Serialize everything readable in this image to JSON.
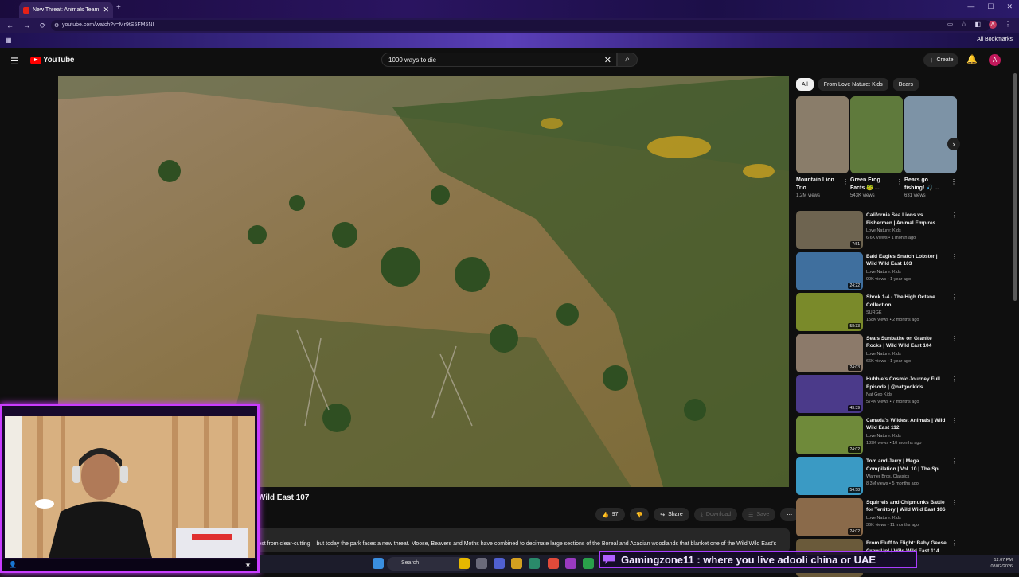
{
  "browser": {
    "tab_title": "New Threat: Animals Team...",
    "new_tab": "+",
    "url": "youtube.com/watch?v=Mr9tS5FM5NI",
    "all_bookmarks": "All Bookmarks",
    "profile_initial": "A"
  },
  "youtube": {
    "logo": "YouTube",
    "search_query": "1000 ways to die",
    "create_label": "Create",
    "avatar_initial": "A"
  },
  "video": {
    "title_visible": "Wild East 107",
    "likes": "97",
    "share": "Share",
    "download": "Download",
    "save": "Save",
    "description": "rest from clear-cutting – but today the park faces a new threat. Moose, Beavers and Moths have combined to decimate large sections of the Boreal and Acadian woodlands that blanket one of the Wild Wild East's"
  },
  "chips": [
    "All",
    "From Love Nature: Kids",
    "Bears"
  ],
  "shorts": [
    {
      "title": "Mountain Lion Trio",
      "views": "1.2M views",
      "thumb": "#8a7d6a"
    },
    {
      "title": "Green Frog Facts 🐸 ...",
      "views": "543K views",
      "thumb": "#5f7a3c"
    },
    {
      "title": "Bears go fishing! 🎣 ...",
      "views": "631 views",
      "thumb": "#7d93a6"
    }
  ],
  "recommended": [
    {
      "title": "California Sea Lions vs. Fishermen | Animal Empires ...",
      "channel": "Love Nature: Kids",
      "meta": "6.6K views • 1 month ago",
      "duration": "7:51",
      "thumb": "#6e6450"
    },
    {
      "title": "Bald Eagles Snatch Lobster | Wild Wild East 103",
      "channel": "Love Nature: Kids",
      "meta": "90K views • 1 year ago",
      "duration": "24:22",
      "thumb": "#3f6f9e"
    },
    {
      "title": "Shrek 1-4 - The High Octane Collection",
      "channel": "SURGE",
      "meta": "158K views • 2 months ago",
      "duration": "58:33",
      "thumb": "#7a8a2a"
    },
    {
      "title": "Seals Sunbathe on Granite Rocks | Wild Wild East 104",
      "channel": "Love Nature: Kids",
      "meta": "66K views • 1 year ago",
      "duration": "24:03",
      "thumb": "#8c7a6a"
    },
    {
      "title": "Hubble's Cosmic Journey Full Episode | @natgeokids",
      "channel": "Nat Geo Kids",
      "meta": "574K views • 7 months ago",
      "duration": "43:39",
      "thumb": "#4b3a8a"
    },
    {
      "title": "Canada's Wildest Animals | Wild Wild East 112",
      "channel": "Love Nature: Kids",
      "meta": "189K views • 10 months ago",
      "duration": "24:02",
      "thumb": "#6f8a3a"
    },
    {
      "title": "Tom and Jerry | Mega Compilation | Vol. 10 | The Spi...",
      "channel": "Warner Bros. Classics",
      "meta": "8.3M views • 5 months ago",
      "duration": "54:58",
      "thumb": "#3a9ac4"
    },
    {
      "title": "Squirrels and Chipmunks Battle for Territory | Wild Wild East 106",
      "channel": "Love Nature: Kids",
      "meta": "36K views • 11 months ago",
      "duration": "24:02",
      "thumb": "#8a6a4a"
    },
    {
      "title": "From Fluff to Flight: Baby Geese Grow Up! | Wild Wild East 114",
      "channel": "",
      "meta": "",
      "duration": "",
      "thumb": "#6a5a3a"
    }
  ],
  "stream": {
    "chat_message": "Gamingzone11 : where you live adooli china or UAE"
  },
  "taskbar": {
    "search": "Search",
    "time": "12:07 PM",
    "date": "08/02/2026"
  },
  "colors": {
    "accent": "#ff0000",
    "overlay": "#c93cff"
  }
}
